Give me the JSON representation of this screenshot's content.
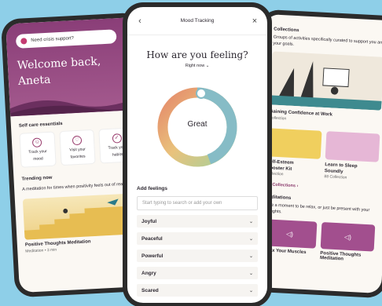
{
  "left": {
    "crisis_label": "Need crisis support?",
    "welcome_line1": "Welcome back,",
    "welcome_line2": "Aneta",
    "essentials_title": "Self care essentials",
    "essentials": [
      {
        "icon": "smile-icon",
        "label_line1": "Track your",
        "label_line2": "mood"
      },
      {
        "icon": "heart-icon",
        "label_line1": "Visit your",
        "label_line2": "favorites"
      },
      {
        "icon": "check-icon",
        "label_line1": "Track your",
        "label_line2": "habits"
      }
    ],
    "trending_title": "Trending now",
    "trending_sub": "A meditation for times when positivity feels out of reach",
    "trending_card_title": "Positive Thoughts Meditation",
    "trending_card_meta": "Meditation • 3 min"
  },
  "center": {
    "header_title": "Mood Tracking",
    "back_glyph": "‹",
    "close_glyph": "×",
    "question": "How are you feeling?",
    "right_now": "Right now ⌄",
    "mood_value": "Great",
    "add_feelings": "Add feelings",
    "search_placeholder": "Start typing to search or add your own",
    "feelings": [
      "Joyful",
      "Peaceful",
      "Powerful",
      "Angry",
      "Scared"
    ]
  },
  "right": {
    "collections_title": "Collections",
    "collections_sub": "Groups of activities specifically curated to support you and your goals.",
    "big_card_title": "Gaining Confidence at Work",
    "big_card_meta": "Collection",
    "small_cards": [
      {
        "title_line1": "Self-Esteem",
        "title_line2": "Booster Kit",
        "meta": "Collection"
      },
      {
        "title_line1": "Learn to Sleep",
        "title_line2": "Soundly",
        "meta": "88 Collection"
      }
    ],
    "all_collections": "All Collections  ›",
    "meditations_title": "Meditations",
    "meditations_sub": "Take a moment to be relax, or just be present with your thoughts.",
    "med_cards": [
      {
        "title": "Relax Your Muscles"
      },
      {
        "title": "Positive Thoughts Meditation"
      }
    ]
  },
  "colors": {
    "background": "#8ecfe8",
    "brand_plum": "#8a3e78",
    "ring_teal": "#7fb7c0",
    "ring_orange": "#e59a6a"
  }
}
